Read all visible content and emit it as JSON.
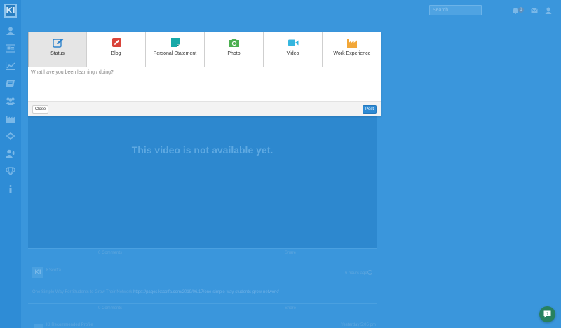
{
  "sidebar": {
    "logo": "KI",
    "icons": [
      "user-icon",
      "id-card-icon",
      "chart-line-icon",
      "book-icon",
      "group-icon",
      "industry-icon",
      "crosshair-icon",
      "add-user-icon",
      "diamond-icon",
      "info-icon"
    ]
  },
  "header": {
    "search_placeholder": "Search",
    "notification_count": "1",
    "icons": [
      "bell-icon",
      "envelope-icon",
      "user-menu-icon"
    ]
  },
  "composer": {
    "tabs": [
      {
        "label": "Status",
        "icon": "pencil-square-icon",
        "color": "#2f84cc",
        "active": true
      },
      {
        "label": "Blog",
        "icon": "pencil-icon",
        "color": "#d9443a",
        "active": false
      },
      {
        "label": "Personal Statement",
        "icon": "sticky-note-icon",
        "color": "#17a9a8",
        "active": false
      },
      {
        "label": "Photo",
        "icon": "camera-icon",
        "color": "#4caf50",
        "active": false
      },
      {
        "label": "Video",
        "icon": "video-camera-icon",
        "color": "#35b6df",
        "active": false
      },
      {
        "label": "Work Experience",
        "icon": "industry-icon",
        "color": "#f2a738",
        "active": false
      }
    ],
    "placeholder": "What have you been learning / doing?",
    "close_label": "Close",
    "post_label": "Post"
  },
  "feed": {
    "video_message": "This video is not available yet.",
    "actions": {
      "comments": "0 Comments",
      "share": "Share"
    },
    "post": {
      "avatar": "KI",
      "author": "KScoffa",
      "time": "6 hours ago",
      "text": "One Simple Way For Students to Grow Their Network",
      "link": "https://pages.kscoffa.com/2019/06/17/one-simple-way-students-grow-network/"
    },
    "post_actions": {
      "comments": "0 Comments",
      "share": "Share"
    },
    "next_post": {
      "author": "KI Recommended Profile",
      "time": "Yesterday 5:05 pm"
    }
  },
  "colors": {
    "accent": "#2d8ad4",
    "overlay": "#3a96dc",
    "chat": "#27815f"
  }
}
